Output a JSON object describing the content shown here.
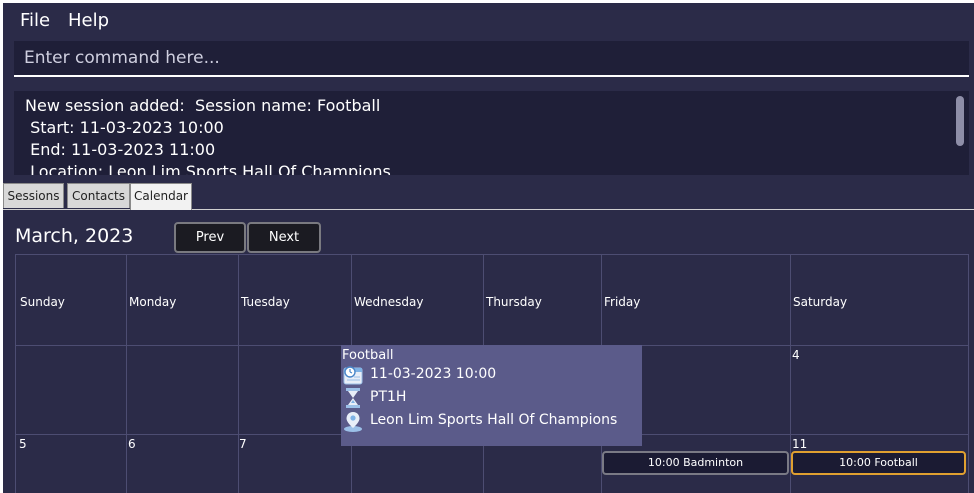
{
  "menu": {
    "file": "File",
    "help": "Help"
  },
  "command": {
    "placeholder": "Enter command here...",
    "value": ""
  },
  "result": {
    "lines": [
      "New session added:  Session name: Football",
      " Start: 11-03-2023 10:00",
      " End: 11-03-2023 11:00",
      " Location: Leon Lim Sports Hall Of Champions"
    ]
  },
  "tabs": [
    {
      "label": "Sessions",
      "active": false
    },
    {
      "label": "Contacts",
      "active": false
    },
    {
      "label": "Calendar",
      "active": true
    }
  ],
  "calendar": {
    "month_label": "March, 2023",
    "prev_label": "Prev",
    "next_label": "Next",
    "days": [
      "Sunday",
      "Monday",
      "Tuesday",
      "Wednesday",
      "Thursday",
      "Friday",
      "Saturday"
    ],
    "row1_dates": {
      "saturday": "4"
    },
    "row2_dates": {
      "sunday": "5",
      "monday": "6",
      "tuesday": "7",
      "saturday": "11"
    },
    "events": [
      {
        "label": "10:00 Badminton",
        "day": "Friday",
        "selected": false
      },
      {
        "label": "10:00 Football",
        "day": "Saturday",
        "selected": true
      }
    ],
    "popup": {
      "title": "Football",
      "start": "11-03-2023 10:00",
      "duration": "PT1H",
      "location": "Leon Lim Sports Hall Of Champions",
      "icons": [
        "calendar-clock-icon",
        "hourglass-icon",
        "location-pin-icon"
      ]
    }
  },
  "colors": {
    "background": "#2b2b48",
    "panel": "#1f1f38",
    "popup": "#5b5b8a",
    "selected_border": "#e0a030"
  }
}
